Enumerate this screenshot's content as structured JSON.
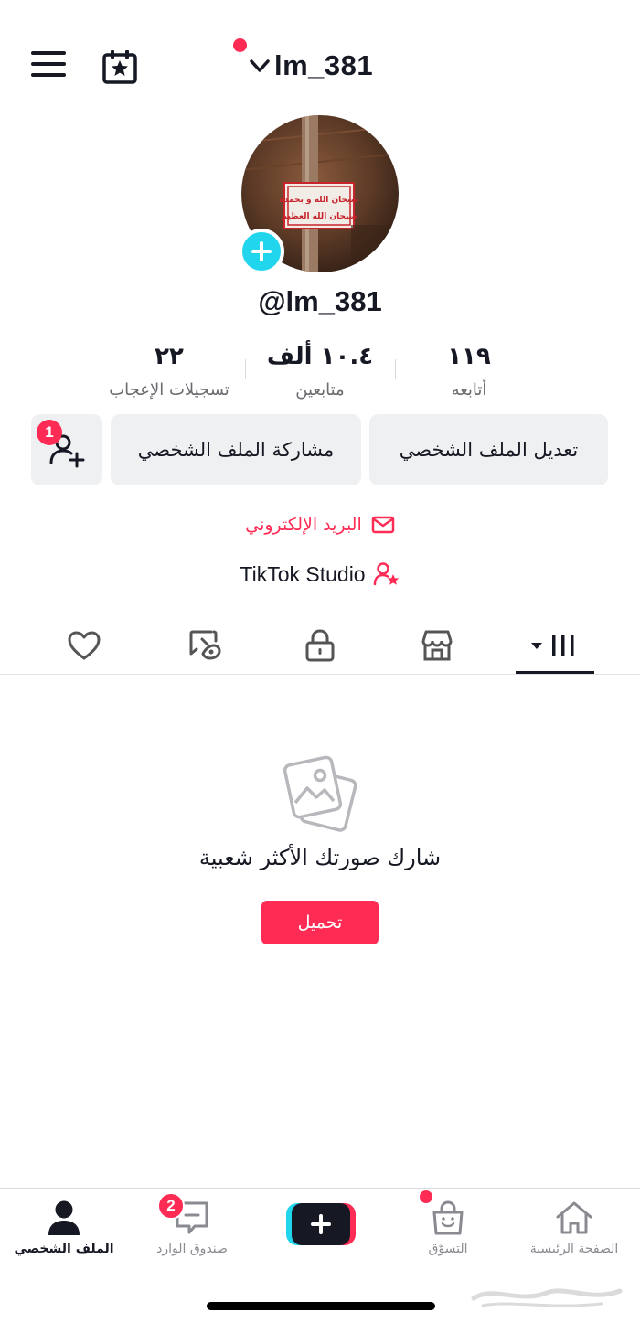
{
  "header": {
    "username": "lm_381",
    "menu_icon": "hamburger-menu-icon",
    "calendar_icon": "calendar-star-icon"
  },
  "profile": {
    "handle": "@lm_381",
    "avatar_sign_line1": "سبحان الله و بحمده",
    "avatar_sign_line2": "سبحان الله العظيم"
  },
  "stats": {
    "likes_value": "٢٢",
    "likes_label": "تسجيلات الإعجاب",
    "followers_value": "١٠.٤ ألف",
    "followers_label": "متابعين",
    "following_value": "١١٩",
    "following_label": "أتابعه"
  },
  "actions": {
    "edit_profile": "تعديل الملف الشخصي",
    "share_profile": "مشاركة الملف الشخصي",
    "add_friends_badge": "1"
  },
  "links": {
    "email": "البريد الإلكتروني",
    "studio": "TikTok Studio"
  },
  "tabs": [
    {
      "name": "videos",
      "icon": "grid-icon",
      "active": true
    },
    {
      "name": "shop",
      "icon": "store-icon"
    },
    {
      "name": "private",
      "icon": "lock-icon"
    },
    {
      "name": "reposts",
      "icon": "repost-icon"
    },
    {
      "name": "liked",
      "icon": "heart-icon"
    }
  ],
  "empty_state": {
    "title": "شارك صورتك الأكثر شعبية",
    "upload_label": "تحميل"
  },
  "bottom_nav": {
    "home": "الصفحة الرئيسية",
    "shop": "التسوّق",
    "inbox": "صندوق الوارد",
    "inbox_badge": "2",
    "profile": "الملف الشخصي"
  },
  "colors": {
    "accent": "#fe2c55",
    "cyan": "#20d5ec",
    "button_bg": "#eff0f1",
    "text": "#161823",
    "muted": "#8a8b91"
  }
}
